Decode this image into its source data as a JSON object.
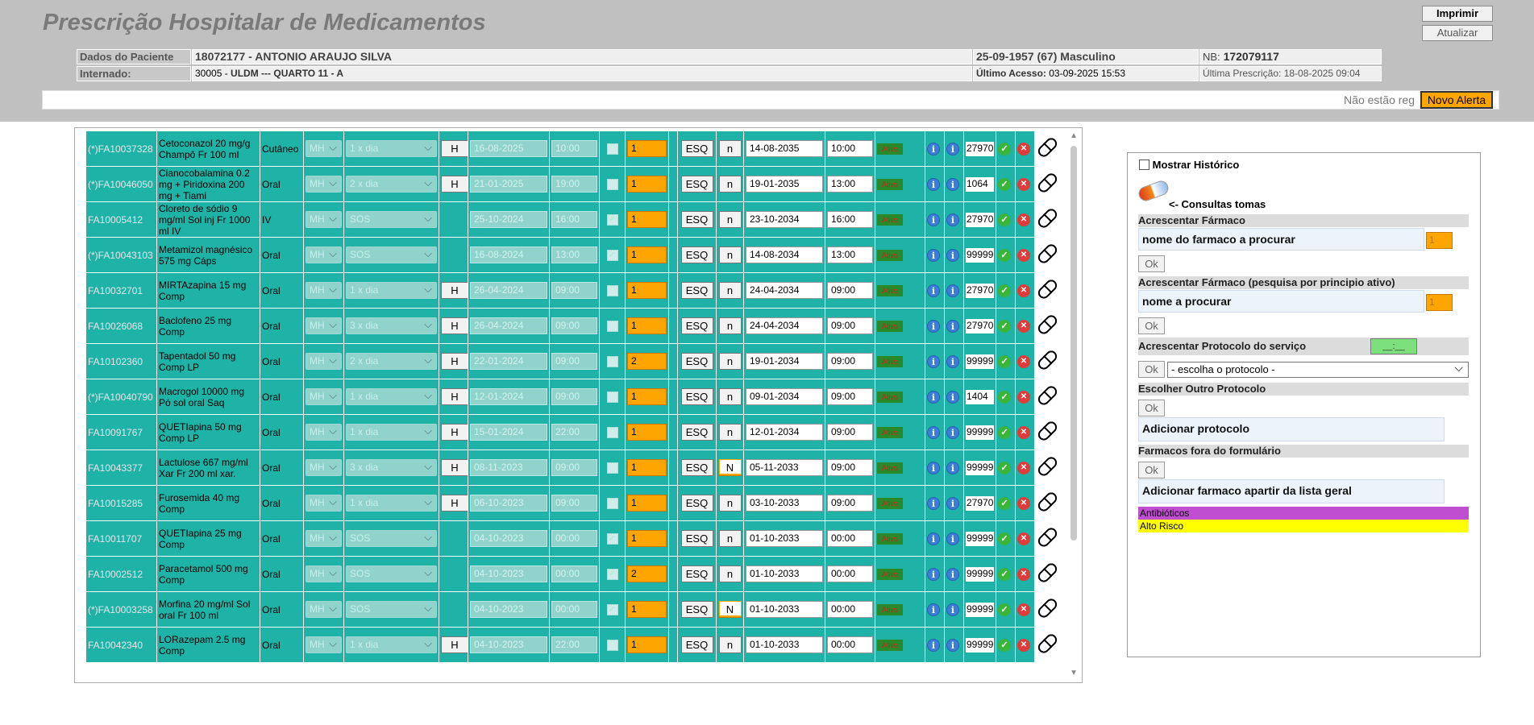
{
  "header": {
    "title": "Prescrição Hospitalar de Medicamentos",
    "print_button": "Imprimir",
    "refresh_button": "Atualizar"
  },
  "patient": {
    "label_patient": "Dados do Paciente",
    "id_name": "18072177 - ANTONIO ARAUJO SILVA",
    "dob_sex": "25-09-1957 (67) Masculino",
    "nb_label": "NB:",
    "nb_value": "172079117",
    "label_admitted": "Internado:",
    "ward_code": "30005 - ",
    "ward_name": "ULDM --- QUARTO 11 - A",
    "last_access_label": "Último Acesso:",
    "last_access": "03-09-2025 15:53",
    "last_prescription_label": "Última Prescrição:",
    "last_prescription": "18-08-2025 09:04"
  },
  "alerts": {
    "text": "Não estão reg",
    "new_alert_button": "Novo Alerta"
  },
  "table": {
    "rows": [
      {
        "code": "(*)FA10037328",
        "drug": "Cetoconazol 20 mg/g Champô Fr 100 ml",
        "via": "Cutâneo",
        "unit": "MH",
        "freq": "1 x dia",
        "h": "H",
        "start_date": "16-08-2025",
        "start_time": "10:00",
        "checked": false,
        "qty": "1",
        "esq": "ESQ",
        "n": "n",
        "end_date": "14-08-2035",
        "end_time": "10:00",
        "status": "Ativo",
        "num": "27970"
      },
      {
        "code": "(*)FA10046050",
        "drug": "Cianocobalamina 0.2 mg + Piridoxina 200 mg + Tiami",
        "via": "Oral",
        "unit": "MH",
        "freq": "2 x dia",
        "h": "H",
        "start_date": "21-01-2025",
        "start_time": "19:00",
        "checked": false,
        "qty": "1",
        "esq": "ESQ",
        "n": "n",
        "end_date": "19-01-2035",
        "end_time": "13:00",
        "status": "Ativo",
        "num": "1064"
      },
      {
        "code": "FA10005412",
        "drug": "Cloreto de sódio 9 mg/ml Sol inj Fr 1000 ml IV",
        "via": "IV",
        "unit": "MH",
        "freq": "SOS",
        "h": "",
        "start_date": "25-10-2024",
        "start_time": "16:00",
        "checked": true,
        "qty": "1",
        "esq": "ESQ",
        "n": "n",
        "end_date": "23-10-2034",
        "end_time": "16:00",
        "status": "Ativo",
        "num": "27970"
      },
      {
        "code": "(*)FA10043103",
        "drug": "Metamizol magnésico 575 mg Cáps",
        "via": "Oral",
        "unit": "MH",
        "freq": "SOS",
        "h": "",
        "start_date": "16-08-2024",
        "start_time": "13:00",
        "checked": true,
        "qty": "1",
        "esq": "ESQ",
        "n": "n",
        "end_date": "14-08-2034",
        "end_time": "13:00",
        "status": "Ativo",
        "num": "99999"
      },
      {
        "code": "FA10032701",
        "drug": "MIRTAzapina 15 mg Comp",
        "via": "Oral",
        "unit": "MH",
        "freq": "1 x dia",
        "h": "H",
        "start_date": "26-04-2024",
        "start_time": "09:00",
        "checked": false,
        "qty": "1",
        "esq": "ESQ",
        "n": "n",
        "end_date": "24-04-2034",
        "end_time": "09:00",
        "status": "Ativo",
        "num": "27970"
      },
      {
        "code": "FA10026068",
        "drug": "Baclofeno 25 mg Comp",
        "via": "Oral",
        "unit": "MH",
        "freq": "3 x dia",
        "h": "H",
        "start_date": "26-04-2024",
        "start_time": "09:00",
        "checked": false,
        "qty": "1",
        "esq": "ESQ",
        "n": "n",
        "end_date": "24-04-2034",
        "end_time": "09:00",
        "status": "Ativo",
        "num": "27970"
      },
      {
        "code": "FA10102360",
        "drug": "Tapentadol 50 mg Comp LP",
        "via": "Oral",
        "unit": "MH",
        "freq": "2 x dia",
        "h": "H",
        "start_date": "22-01-2024",
        "start_time": "09:00",
        "checked": false,
        "qty": "2",
        "esq": "ESQ",
        "n": "n",
        "end_date": "19-01-2034",
        "end_time": "09:00",
        "status": "Ativo",
        "num": "99999"
      },
      {
        "code": "(*)FA10040790",
        "drug": "Macrogol 10000 mg Pó sol oral Saq",
        "via": "Oral",
        "unit": "MH",
        "freq": "1 x dia",
        "h": "H",
        "start_date": "12-01-2024",
        "start_time": "09:00",
        "checked": false,
        "qty": "1",
        "esq": "ESQ",
        "n": "n",
        "end_date": "09-01-2034",
        "end_time": "09:00",
        "status": "Ativo",
        "num": "1404"
      },
      {
        "code": "FA10091767",
        "drug": "QUETIapina 50 mg Comp LP",
        "via": "Oral",
        "unit": "MH",
        "freq": "1 x dia",
        "h": "H",
        "start_date": "15-01-2024",
        "start_time": "22:00",
        "checked": false,
        "qty": "1",
        "esq": "ESQ",
        "n": "n",
        "end_date": "12-01-2034",
        "end_time": "09:00",
        "status": "Ativo",
        "num": "99999"
      },
      {
        "code": "FA10043377",
        "drug": "Lactulose 667 mg/ml Xar Fr 200 ml xar.",
        "via": "Oral",
        "unit": "MH",
        "freq": "3 x dia",
        "h": "H",
        "start_date": "08-11-2023",
        "start_time": "09:00",
        "checked": false,
        "qty": "1",
        "esq": "ESQ",
        "n": "N",
        "end_date": "05-11-2033",
        "end_time": "09:00",
        "status": "Ativo",
        "num": "99999"
      },
      {
        "code": "FA10015285",
        "drug": "Furosemida 40 mg Comp",
        "via": "Oral",
        "unit": "MH",
        "freq": "1 x dia",
        "h": "H",
        "start_date": "06-10-2023",
        "start_time": "09:00",
        "checked": false,
        "qty": "1",
        "esq": "ESQ",
        "n": "n",
        "end_date": "03-10-2033",
        "end_time": "09:00",
        "status": "Ativo",
        "num": "27970"
      },
      {
        "code": "FA10011707",
        "drug": "QUETIapina 25 mg Comp",
        "via": "Oral",
        "unit": "MH",
        "freq": "SOS",
        "h": "",
        "start_date": "04-10-2023",
        "start_time": "00:00",
        "checked": true,
        "qty": "1",
        "esq": "ESQ",
        "n": "n",
        "end_date": "01-10-2033",
        "end_time": "00:00",
        "status": "Ativo",
        "num": "99999"
      },
      {
        "code": "FA10002512",
        "drug": "Paracetamol 500 mg Comp",
        "via": "Oral",
        "unit": "MH",
        "freq": "SOS",
        "h": "",
        "start_date": "04-10-2023",
        "start_time": "00:00",
        "checked": true,
        "qty": "2",
        "esq": "ESQ",
        "n": "n",
        "end_date": "01-10-2033",
        "end_time": "00:00",
        "status": "Ativo",
        "num": "99999"
      },
      {
        "code": "(*)FA10003258",
        "drug": "Morfina 20 mg/ml Sol oral Fr 100 ml",
        "via": "Oral",
        "unit": "MH",
        "freq": "SOS",
        "h": "",
        "start_date": "04-10-2023",
        "start_time": "00:00",
        "checked": true,
        "qty": "1",
        "esq": "ESQ",
        "n": "N",
        "end_date": "01-10-2033",
        "end_time": "00:00",
        "status": "Ativo",
        "num": "99999"
      },
      {
        "code": "FA10042340",
        "drug": "LORazepam 2.5 mg Comp",
        "via": "Oral",
        "unit": "MH",
        "freq": "1 x dia",
        "h": "H",
        "start_date": "04-10-2023",
        "start_time": "22:00",
        "checked": false,
        "qty": "1",
        "esq": "ESQ",
        "n": "n",
        "end_date": "01-10-2033",
        "end_time": "00:00",
        "status": "Ativo",
        "num": "99999"
      }
    ]
  },
  "side": {
    "show_history": "Mostrar Histórico",
    "consult_label": "<- Consultas tomas",
    "add_drug_head": "Acrescentar Fármaco",
    "add_drug_placeholder": "nome do farmaco a procurar",
    "add_drug_qty": "1",
    "ok": "Ok",
    "add_drug_active_head": "Acrescentar Fármaco (pesquisa por principio ativo)",
    "add_drug_active_placeholder": "nome a procurar",
    "add_drug_active_qty": "1",
    "add_protocol_head": "Acrescentar Protocolo do serviço",
    "protocol_time": "__:__",
    "protocol_select": "- escolha o protocolo -",
    "other_protocol_head": "Escolher Outro Protocolo",
    "add_protocol_button": "Adicionar protocolo",
    "off_form_head": "Farmacos fora do formulário",
    "add_general_button": "Adicionar farmaco apartir da lista geral",
    "legend_antibiotics": "Antibióticos",
    "legend_high_risk": "Alto Risco"
  },
  "colors": {
    "row_bg": "#1fb3a8",
    "accent_orange": "#ffa500",
    "antibiotics": "#c04ed0",
    "high_risk": "#ffff00"
  }
}
